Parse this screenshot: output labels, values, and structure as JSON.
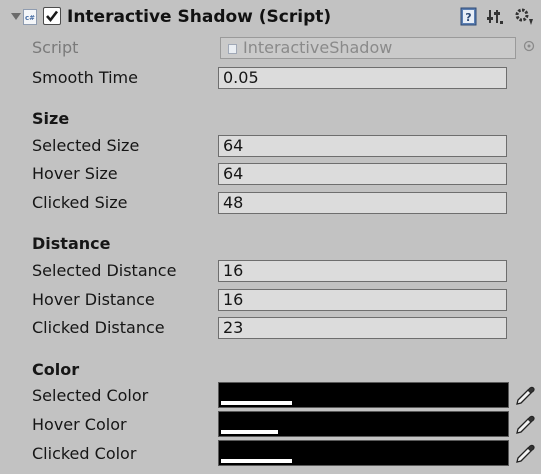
{
  "component": {
    "icon": "csharp-script-icon",
    "enabled": true,
    "title": "Interactive Shadow (Script)",
    "header_icons": [
      "help-book-icon",
      "presets-icon",
      "gear-icon"
    ]
  },
  "script": {
    "label": "Script",
    "value": "InteractiveShadow"
  },
  "smooth_time": {
    "label": "Smooth Time",
    "value": "0.05"
  },
  "size": {
    "header": "Size",
    "selected": {
      "label": "Selected Size",
      "value": "64"
    },
    "hover": {
      "label": "Hover Size",
      "value": "64"
    },
    "clicked": {
      "label": "Clicked Size",
      "value": "48"
    }
  },
  "distance": {
    "header": "Distance",
    "selected": {
      "label": "Selected Distance",
      "value": "16"
    },
    "hover": {
      "label": "Hover Distance",
      "value": "16"
    },
    "clicked": {
      "label": "Clicked Distance",
      "value": "23"
    }
  },
  "color": {
    "header": "Color",
    "selected": {
      "label": "Selected Color",
      "swatch": "#000000",
      "alpha_fraction": 0.25
    },
    "hover": {
      "label": "Hover Color",
      "swatch": "#000000",
      "alpha_fraction": 0.2
    },
    "clicked": {
      "label": "Clicked Color",
      "swatch": "#000000",
      "alpha_fraction": 0.25
    }
  },
  "colors": {
    "panel": "#c2c2c2",
    "field": "#dcdcdc",
    "text": "#161616",
    "dim_text": "#7a7a7a"
  }
}
